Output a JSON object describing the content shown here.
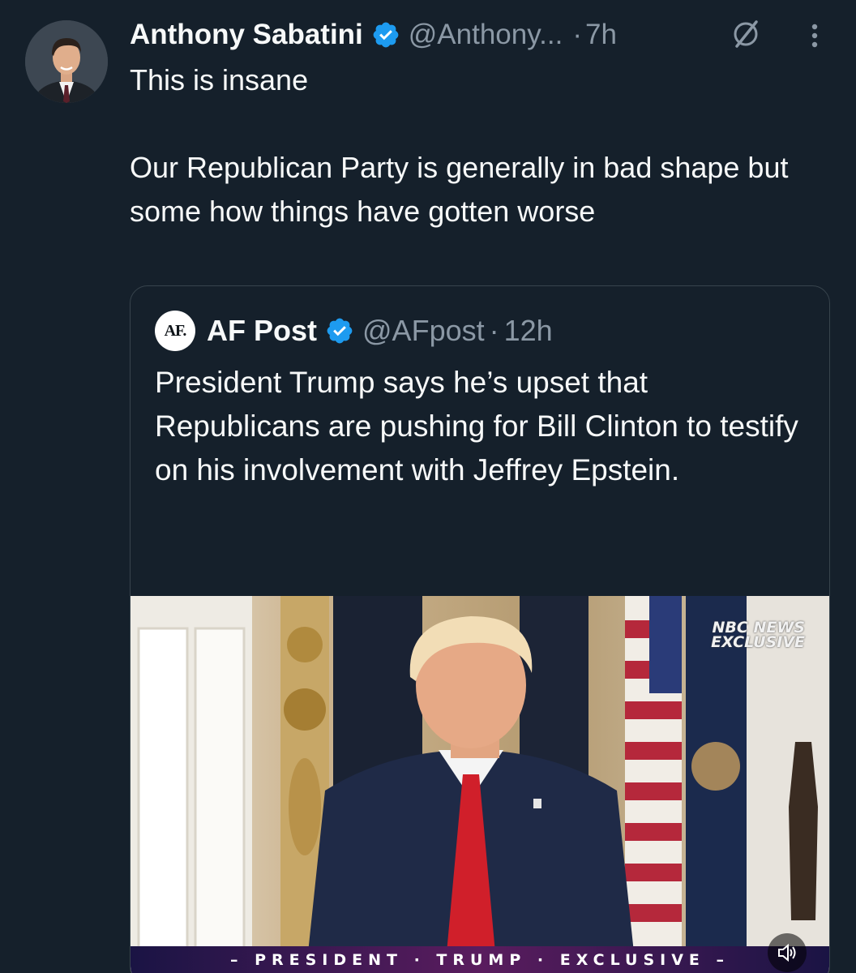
{
  "tweet": {
    "author_name": "Anthony Sabatini",
    "handle": "@Anthony...",
    "separator": "·",
    "time": "7h",
    "text_lines": [
      "This is insane",
      "Our Republican Party is generally in bad shape but some how things have gotten worse"
    ]
  },
  "quoted": {
    "logo_text": "AF.",
    "author_name": "AF Post",
    "handle": "@AFpost",
    "separator": "·",
    "time": "12h",
    "text": "President Trump says he’s upset that Republicans are pushing for Bill Clinton to testify on his involvement with Jeffrey Epstein.",
    "ellipsis": "...",
    "media": {
      "network_line1": "NBC NEWS",
      "network_line2": "EXCLUSIVE",
      "banner": "– PRESIDENT · TRUMP · EXCLUSIVE –"
    }
  },
  "colors": {
    "background": "#15202b",
    "verified": "#1d9bf0",
    "secondary_text": "#8b98a5",
    "border": "#38444d"
  },
  "icons": [
    "verified-badge-icon",
    "grok-icon",
    "more-options-icon",
    "sound-icon"
  ]
}
